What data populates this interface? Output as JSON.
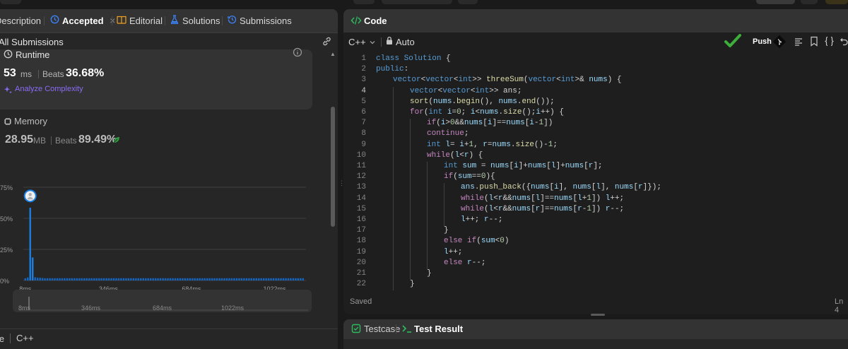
{
  "left_tabs": [
    {
      "label": "Description",
      "icon": "document-icon"
    },
    {
      "label": "Accepted",
      "icon": "clock-icon"
    },
    {
      "label": "Editorial",
      "icon": "book-icon"
    },
    {
      "label": "Solutions",
      "icon": "flask-icon"
    },
    {
      "label": "Submissions",
      "icon": "history-icon"
    }
  ],
  "close_glyph": "×",
  "all_submissions_label": "All Submissions",
  "runtime": {
    "title": "Runtime",
    "value": "53",
    "unit": "ms",
    "beats_label": "Beats",
    "beats_value": "36.68%",
    "analyze_label": "Analyze Complexity"
  },
  "memory": {
    "title": "Memory",
    "value": "28.95",
    "unit": "MB",
    "beats_label": "Beats",
    "beats_value": "89.49%"
  },
  "chart_data": {
    "type": "bar",
    "ytick_labels": [
      "75%",
      "50%",
      "25%",
      "0%"
    ],
    "yticks": [
      75,
      50,
      25,
      0
    ],
    "ylim": [
      0,
      75
    ],
    "xtick_labels": [
      "8ms",
      "346ms",
      "684ms",
      "1022ms"
    ],
    "xticks": [
      8,
      346,
      684,
      1022
    ],
    "xlim": [
      0,
      1150
    ],
    "bar_width_ms": 10,
    "bars": [
      {
        "x": 8,
        "y": 1.8
      },
      {
        "x": 18,
        "y": 2.4
      },
      {
        "x": 28,
        "y": 58.5
      },
      {
        "x": 38,
        "y": 18.5
      },
      {
        "x": 48,
        "y": 2.6
      },
      {
        "x": 58,
        "y": 2.2
      },
      {
        "x": 68,
        "y": 2.2
      },
      {
        "x": 78,
        "y": 2.0
      }
    ],
    "tail_start": 88,
    "tail_end": 1140,
    "tail_step": 10,
    "tail_value": 1.8,
    "marker": {
      "x": 28,
      "y": 68
    },
    "range_labels": [
      "8ms",
      "346ms",
      "684ms",
      "1022ms"
    ],
    "colors": {
      "bar": "#1a7ee0",
      "bar_small": "#1565c0",
      "grid": "#3d3d3d",
      "axis_text": "#9a9a9a"
    }
  },
  "bottom_left": {
    "lang_partial": "le",
    "lang": "C++"
  },
  "code_panel": {
    "title": "Code",
    "language": "C++",
    "mode": "Auto",
    "push_label": "Push",
    "saved_label": "Saved",
    "cursor_pos": "Ln 4"
  },
  "bottom_panel": {
    "testcase_label": "Testcase",
    "result_label": "Test Result"
  },
  "code_lines": [
    {
      "n": "1",
      "indent": 0,
      "html": "<span class=\"ty\">class</span> <span class=\"ty\">Solution</span> {"
    },
    {
      "n": "2",
      "indent": 0,
      "html": "<span class=\"ty\">public</span>:"
    },
    {
      "n": "3",
      "indent": 1,
      "html": "<span class=\"ty\">vector</span>&lt;<span class=\"ty\">vector</span>&lt;<span class=\"ty\">int</span>&gt;&gt; <span class=\"fn\">threeSum</span>(<span class=\"ty\">vector</span>&lt;<span class=\"ty\">int</span>&gt;&amp; <span class=\"vr\">nums</span>) {"
    },
    {
      "n": "4",
      "indent": 2,
      "html": "<span class=\"ty\">vector</span>&lt;<span class=\"ty\">vector</span>&lt;<span class=\"ty\">int</span>&gt;&gt; ans;"
    },
    {
      "n": "5",
      "indent": 2,
      "html": "<span class=\"fn\">sort</span>(<span class=\"vr\">nums</span>.<span class=\"fn\">begin</span>(), <span class=\"vr\">nums</span>.<span class=\"fn\">end</span>());"
    },
    {
      "n": "6",
      "indent": 2,
      "html": "<span class=\"kw\">for</span>(<span class=\"ty\">int</span> <span class=\"vr\">i</span>=<span class=\"nm\">0</span>; <span class=\"vr\">i</span>&lt;<span class=\"vr\">nums</span>.<span class=\"fn\">size</span>();<span class=\"vr\">i</span>++) {"
    },
    {
      "n": "7",
      "indent": 3,
      "html": "<span class=\"kw\">if</span>(<span class=\"vr\">i</span>&gt;<span class=\"nm\">0</span>&amp;&amp;<span class=\"vr\">nums</span>[<span class=\"vr\">i</span>]==<span class=\"vr\">nums</span>[<span class=\"vr\">i</span>-<span class=\"nm\">1</span>])"
    },
    {
      "n": "8",
      "indent": 3,
      "html": "<span class=\"kw\">continue</span>;"
    },
    {
      "n": "9",
      "indent": 3,
      "html": "<span class=\"ty\">int</span> <span class=\"vr\">l</span>= <span class=\"vr\">i</span>+<span class=\"nm\">1</span>, <span class=\"vr\">r</span>=<span class=\"vr\">nums</span>.<span class=\"fn\">size</span>()-<span class=\"nm\">1</span>;"
    },
    {
      "n": "10",
      "indent": 3,
      "html": "<span class=\"kw\">while</span>(<span class=\"vr\">l</span>&lt;<span class=\"vr\">r</span>) {"
    },
    {
      "n": "11",
      "indent": 4,
      "html": "<span class=\"ty\">int</span> <span class=\"vr\">sum</span> = <span class=\"vr\">nums</span>[<span class=\"vr\">i</span>]+<span class=\"vr\">nums</span>[<span class=\"vr\">l</span>]+<span class=\"vr\">nums</span>[<span class=\"vr\">r</span>];"
    },
    {
      "n": "12",
      "indent": 4,
      "html": "<span class=\"kw\">if</span>(<span class=\"vr\">sum</span>==<span class=\"nm\">0</span>){"
    },
    {
      "n": "13",
      "indent": 5,
      "html": "<span class=\"vr\">ans</span>.<span class=\"fn\">push_back</span>({<span class=\"vr\">nums</span>[<span class=\"vr\">i</span>], <span class=\"vr\">nums</span>[<span class=\"vr\">l</span>], <span class=\"vr\">nums</span>[<span class=\"vr\">r</span>]});"
    },
    {
      "n": "14",
      "indent": 5,
      "html": "<span class=\"kw\">while</span>(<span class=\"vr\">l</span>&lt;<span class=\"vr\">r</span>&amp;&amp;<span class=\"vr\">nums</span>[<span class=\"vr\">l</span>]==<span class=\"vr\">nums</span>[<span class=\"vr\">l</span>+<span class=\"nm\">1</span>]) <span class=\"vr\">l</span>++;"
    },
    {
      "n": "15",
      "indent": 5,
      "html": "<span class=\"kw\">while</span>(<span class=\"vr\">l</span>&lt;<span class=\"vr\">r</span>&amp;&amp;<span class=\"vr\">nums</span>[<span class=\"vr\">r</span>]==<span class=\"vr\">nums</span>[<span class=\"vr\">r</span>-<span class=\"nm\">1</span>]) <span class=\"vr\">r</span>--;"
    },
    {
      "n": "16",
      "indent": 5,
      "html": "<span class=\"vr\">l</span>++; <span class=\"vr\">r</span>--;"
    },
    {
      "n": "17",
      "indent": 4,
      "html": "}"
    },
    {
      "n": "18",
      "indent": 4,
      "html": "<span class=\"kw\">else if</span>(<span class=\"vr\">sum</span>&lt;<span class=\"nm\">0</span>)"
    },
    {
      "n": "19",
      "indent": 4,
      "html": "<span class=\"vr\">l</span>++;"
    },
    {
      "n": "20",
      "indent": 4,
      "html": "<span class=\"kw\">else</span> <span class=\"vr\">r</span>--;"
    },
    {
      "n": "21",
      "indent": 3,
      "html": "}"
    },
    {
      "n": "22",
      "indent": 2,
      "html": "}"
    }
  ]
}
